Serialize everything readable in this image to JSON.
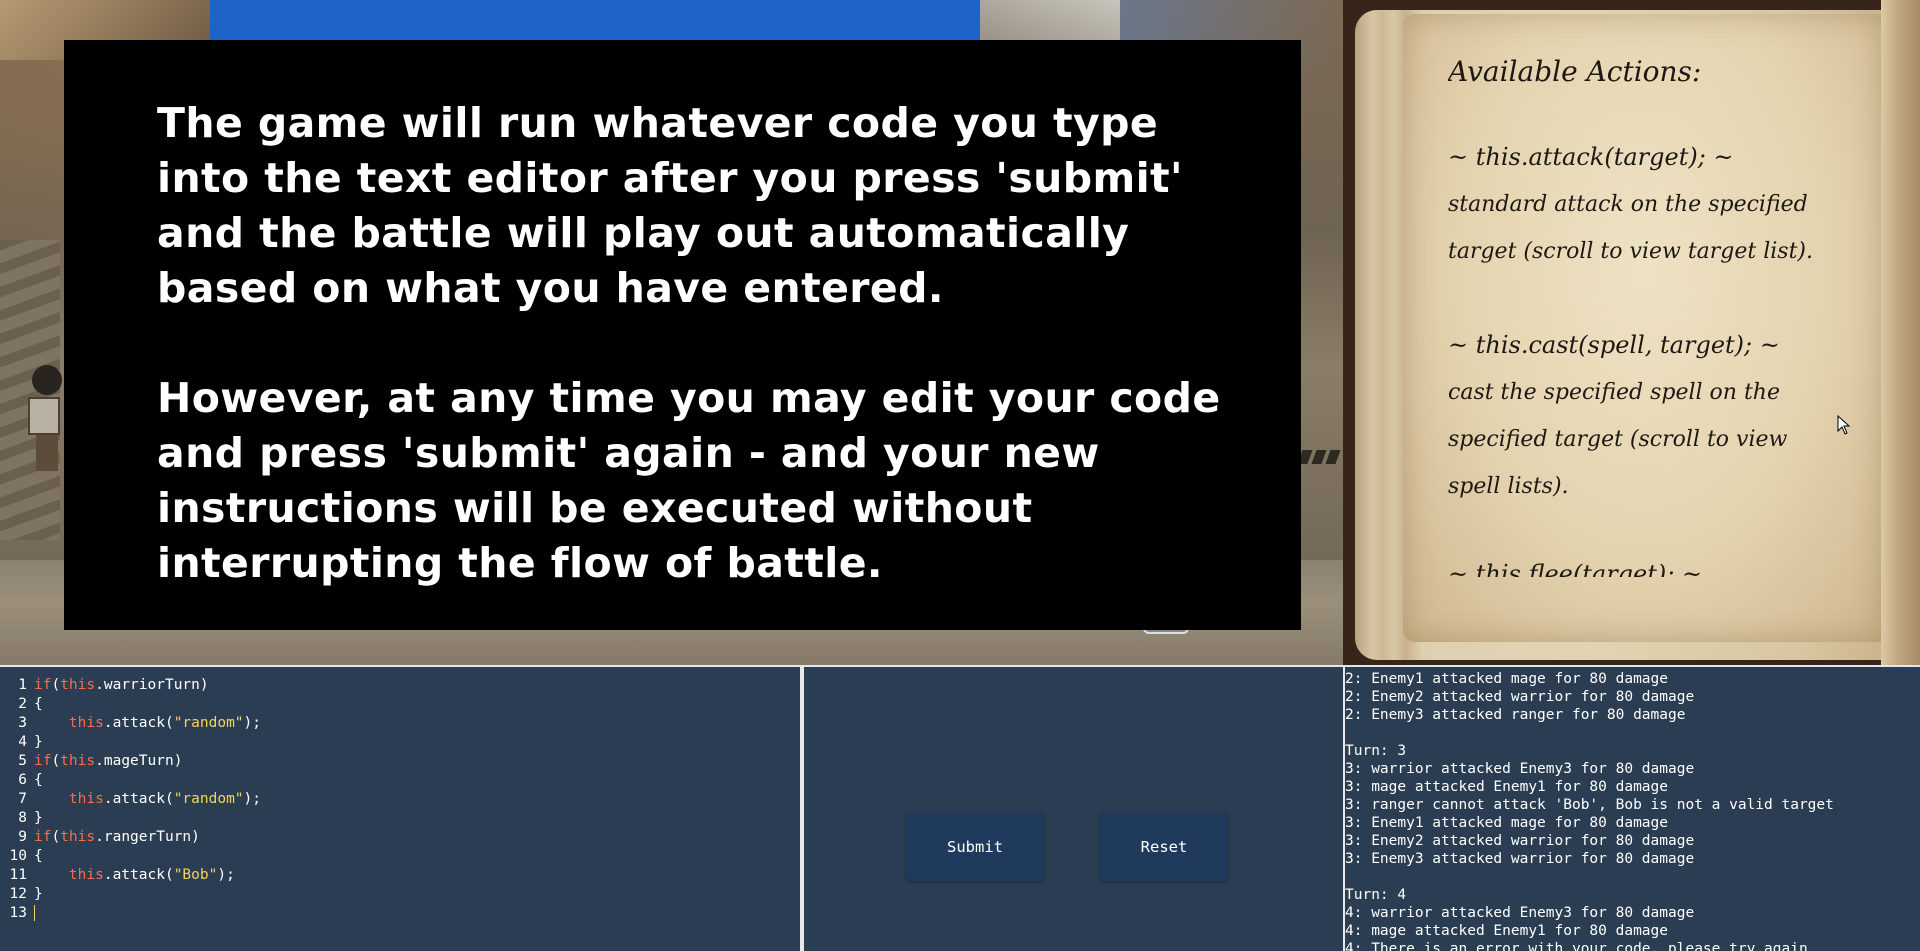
{
  "tutorial": {
    "paragraph_1": "The game will run whatever code you type into the text editor after you press 'submit' and the battle will play out automatically based on what you have entered.",
    "paragraph_2": "However, at any time you may edit your code and press 'submit' again - and your new instructions will be executed without interrupting the flow of battle."
  },
  "book": {
    "title": "Available Actions:",
    "actions": [
      {
        "signature": "~ this.attack(target); ~",
        "description_lines": [
          "standard attack on the specified",
          "target (scroll to view target list)."
        ]
      },
      {
        "signature": "~ this.cast(spell, target); ~",
        "description_lines": [
          "cast the specified spell on the",
          "specified target (scroll to view",
          "spell lists)."
        ]
      }
    ],
    "partial_line": "~ this.flee(target); ~"
  },
  "editor": {
    "lines": [
      {
        "n": "1",
        "parts": [
          [
            "kw",
            "if"
          ],
          [
            "t",
            "("
          ],
          [
            "kw",
            "this"
          ],
          [
            "t",
            ".warriorTurn)"
          ]
        ]
      },
      {
        "n": "2",
        "parts": [
          [
            "t",
            "{"
          ]
        ]
      },
      {
        "n": "3",
        "parts": [
          [
            "t",
            "    "
          ],
          [
            "kw",
            "this"
          ],
          [
            "t",
            ".attack("
          ],
          [
            "str",
            "\"random\""
          ],
          [
            "t",
            ");"
          ]
        ]
      },
      {
        "n": "4",
        "parts": [
          [
            "t",
            "}"
          ]
        ]
      },
      {
        "n": "5",
        "parts": [
          [
            "kw",
            "if"
          ],
          [
            "t",
            "("
          ],
          [
            "kw",
            "this"
          ],
          [
            "t",
            ".mageTurn)"
          ]
        ]
      },
      {
        "n": "6",
        "parts": [
          [
            "t",
            "{"
          ]
        ]
      },
      {
        "n": "7",
        "parts": [
          [
            "t",
            "    "
          ],
          [
            "kw",
            "this"
          ],
          [
            "t",
            ".attack("
          ],
          [
            "str",
            "\"random\""
          ],
          [
            "t",
            ");"
          ]
        ]
      },
      {
        "n": "8",
        "parts": [
          [
            "t",
            "}"
          ]
        ]
      },
      {
        "n": "9",
        "parts": [
          [
            "kw",
            "if"
          ],
          [
            "t",
            "("
          ],
          [
            "kw",
            "this"
          ],
          [
            "t",
            ".rangerTurn)"
          ]
        ]
      },
      {
        "n": "10",
        "parts": [
          [
            "t",
            "{"
          ]
        ]
      },
      {
        "n": "11",
        "parts": [
          [
            "t",
            "    "
          ],
          [
            "kw",
            "this"
          ],
          [
            "t",
            ".attack("
          ],
          [
            "str",
            "\"Bob\""
          ],
          [
            "t",
            ");"
          ]
        ]
      },
      {
        "n": "12",
        "parts": [
          [
            "t",
            "}"
          ]
        ]
      },
      {
        "n": "13",
        "parts": []
      }
    ]
  },
  "controls": {
    "submit_label": "Submit",
    "reset_label": "Reset"
  },
  "log": {
    "lines": [
      "2: Enemy1 attacked mage for 80 damage",
      "2: Enemy2 attacked warrior for 80 damage",
      "2: Enemy3 attacked ranger for 80 damage",
      "",
      "Turn: 3",
      "3: warrior attacked Enemy3 for 80 damage",
      "3: mage attacked Enemy1 for 80 damage",
      "3: ranger cannot attack 'Bob', Bob is not a valid target",
      "3: Enemy1 attacked mage for 80 damage",
      "3: Enemy2 attacked warrior for 80 damage",
      "3: Enemy3 attacked warrior for 80 damage",
      "",
      "Turn: 4",
      "4: warrior attacked Enemy3 for 80 damage",
      "4: mage attacked Enemy1 for 80 damage",
      "4: There is an error with your code, please try again"
    ]
  },
  "colors": {
    "panel_bg": "#2b3d52",
    "keyword": "#ff6b4a",
    "string": "#f1d45c",
    "button_bg": "#1f3a5c",
    "overlay_bg": "#000000"
  },
  "icons": [
    "mouse-cursor-icon"
  ]
}
